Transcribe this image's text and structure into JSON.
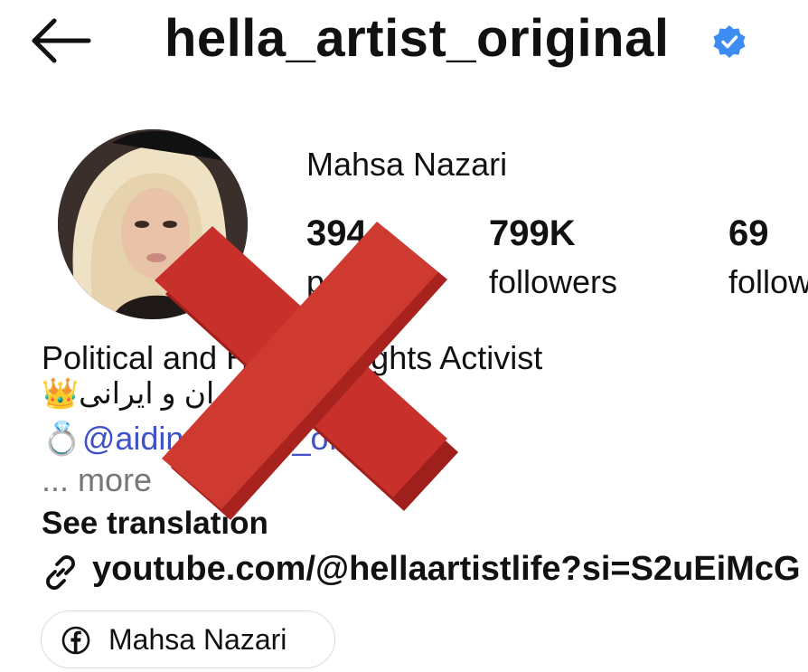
{
  "header": {
    "back_icon": "arrow-left-icon",
    "handle": "hella_artist_original",
    "verified_icon": "verified-badge-icon",
    "verified_color": "#3d8cf2"
  },
  "profile": {
    "display_name": "Mahsa Nazari",
    "stats": [
      {
        "value": "394",
        "label": "posts"
      },
      {
        "value": "799K",
        "label": "followers"
      },
      {
        "value": "69",
        "label": "following"
      }
    ]
  },
  "bio": {
    "line1": "Political and Human Rights Activist",
    "line2": "👑ملکه ایران و ایرانی👑",
    "line3_emoji": "💍",
    "line3_mention": "@aidin_naderi_official",
    "more": "... more",
    "see_translation": "See translation"
  },
  "link": {
    "icon": "link-icon",
    "text": "youtube.com/@hellaartistlife?si=S2uEiMcG"
  },
  "facebook": {
    "icon": "facebook-icon",
    "label": "Mahsa Nazari"
  },
  "overlay": {
    "icon": "red-cross-icon",
    "color": "#c8302b"
  }
}
